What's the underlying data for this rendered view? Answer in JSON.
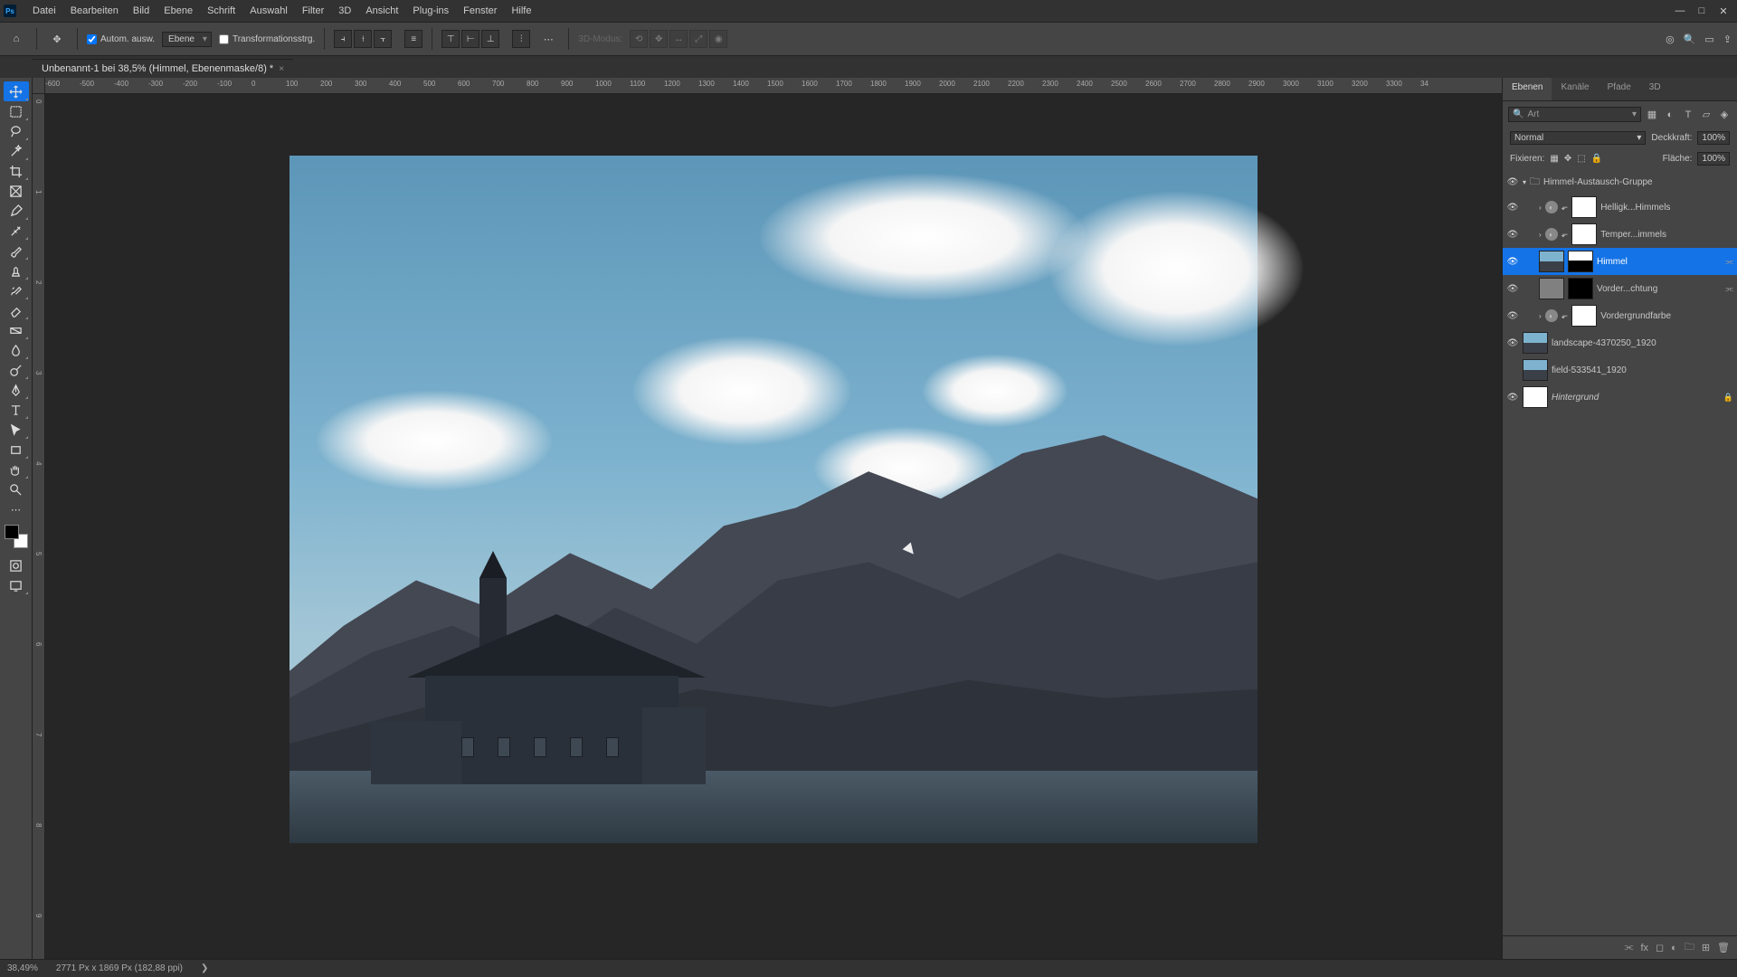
{
  "menu": {
    "items": [
      "Datei",
      "Bearbeiten",
      "Bild",
      "Ebene",
      "Schrift",
      "Auswahl",
      "Filter",
      "3D",
      "Ansicht",
      "Plug-ins",
      "Fenster",
      "Hilfe"
    ]
  },
  "options": {
    "auto_select": "Autom. ausw.",
    "layer_target": "Ebene",
    "transform_controls": "Transformationsstrg.",
    "mode_label": "3D-Modus:"
  },
  "document": {
    "tab_title": "Unbenannt-1 bei 38,5% (Himmel, Ebenenmaske/8) *"
  },
  "ruler": {
    "marks": [
      "-600",
      "-500",
      "-400",
      "-300",
      "-200",
      "-100",
      "0",
      "100",
      "200",
      "300",
      "400",
      "500",
      "600",
      "700",
      "800",
      "900",
      "1000",
      "1100",
      "1200",
      "1300",
      "1400",
      "1500",
      "1600",
      "1700",
      "1800",
      "1900",
      "2000",
      "2100",
      "2200",
      "2300",
      "2400",
      "2500",
      "2600",
      "2700",
      "2800",
      "2900",
      "3000",
      "3100",
      "3200",
      "3300",
      "34"
    ],
    "vmarks": [
      "0",
      "1",
      "2",
      "3",
      "4",
      "5",
      "6",
      "7",
      "8",
      "9"
    ]
  },
  "panel": {
    "tabs": [
      "Ebenen",
      "Kanäle",
      "Pfade",
      "3D"
    ],
    "search_placeholder": "Art",
    "blend_mode": "Normal",
    "opacity_label": "Deckkraft:",
    "opacity_value": "100%",
    "lock_label": "Fixieren:",
    "fill_label": "Fläche:",
    "fill_value": "100%"
  },
  "layers": [
    {
      "kind": "group",
      "name": "Himmel-Austausch-Gruppe",
      "indent": 0
    },
    {
      "kind": "adj",
      "name": "Helligk...Himmels",
      "indent": 1
    },
    {
      "kind": "adj",
      "name": "Temper...immels",
      "indent": 1
    },
    {
      "kind": "img_mask",
      "name": "Himmel",
      "indent": 1,
      "selected": true,
      "link": true
    },
    {
      "kind": "grey_mask",
      "name": "Vorder...chtung",
      "indent": 1,
      "link": true
    },
    {
      "kind": "adj",
      "name": "Vordergrundfarbe",
      "indent": 1
    },
    {
      "kind": "img",
      "name": "landscape-4370250_1920",
      "indent": 0
    },
    {
      "kind": "img",
      "name": "field-533541_1920",
      "indent": 0,
      "hidden": true
    },
    {
      "kind": "bg",
      "name": "Hintergrund",
      "indent": 0,
      "locked": true,
      "italic": true
    }
  ],
  "status": {
    "zoom": "38,49%",
    "dims": "2771 Px x 1869 Px (182,88 ppi)"
  }
}
